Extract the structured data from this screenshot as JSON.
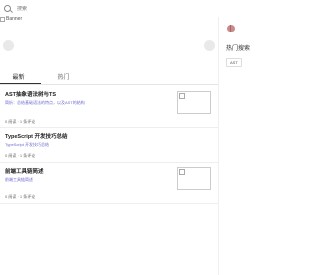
{
  "search": {
    "placeholder": "搜索"
  },
  "banner": {
    "alt_text": "Banner"
  },
  "tabs": [
    {
      "label": "最新"
    },
    {
      "label": "热门"
    }
  ],
  "articles": [
    {
      "title": "AST抽象语法树与TS",
      "summary": "简析：总结基础语法的特点，以及AST的结构",
      "views": "0 阅读",
      "comments": "1 条评论"
    },
    {
      "title": "TypeScript 开发技巧总结",
      "summary": "TypeScript 开发技巧总结",
      "views": "0 阅读",
      "comments": "1 条评论"
    },
    {
      "title": "前端工具链简述",
      "summary": "前端工具链简述",
      "views": "0 阅读",
      "comments": "1 条评论"
    }
  ],
  "sidebar": {
    "hot_search_title": "热门搜索",
    "tags": [
      "AST"
    ]
  }
}
